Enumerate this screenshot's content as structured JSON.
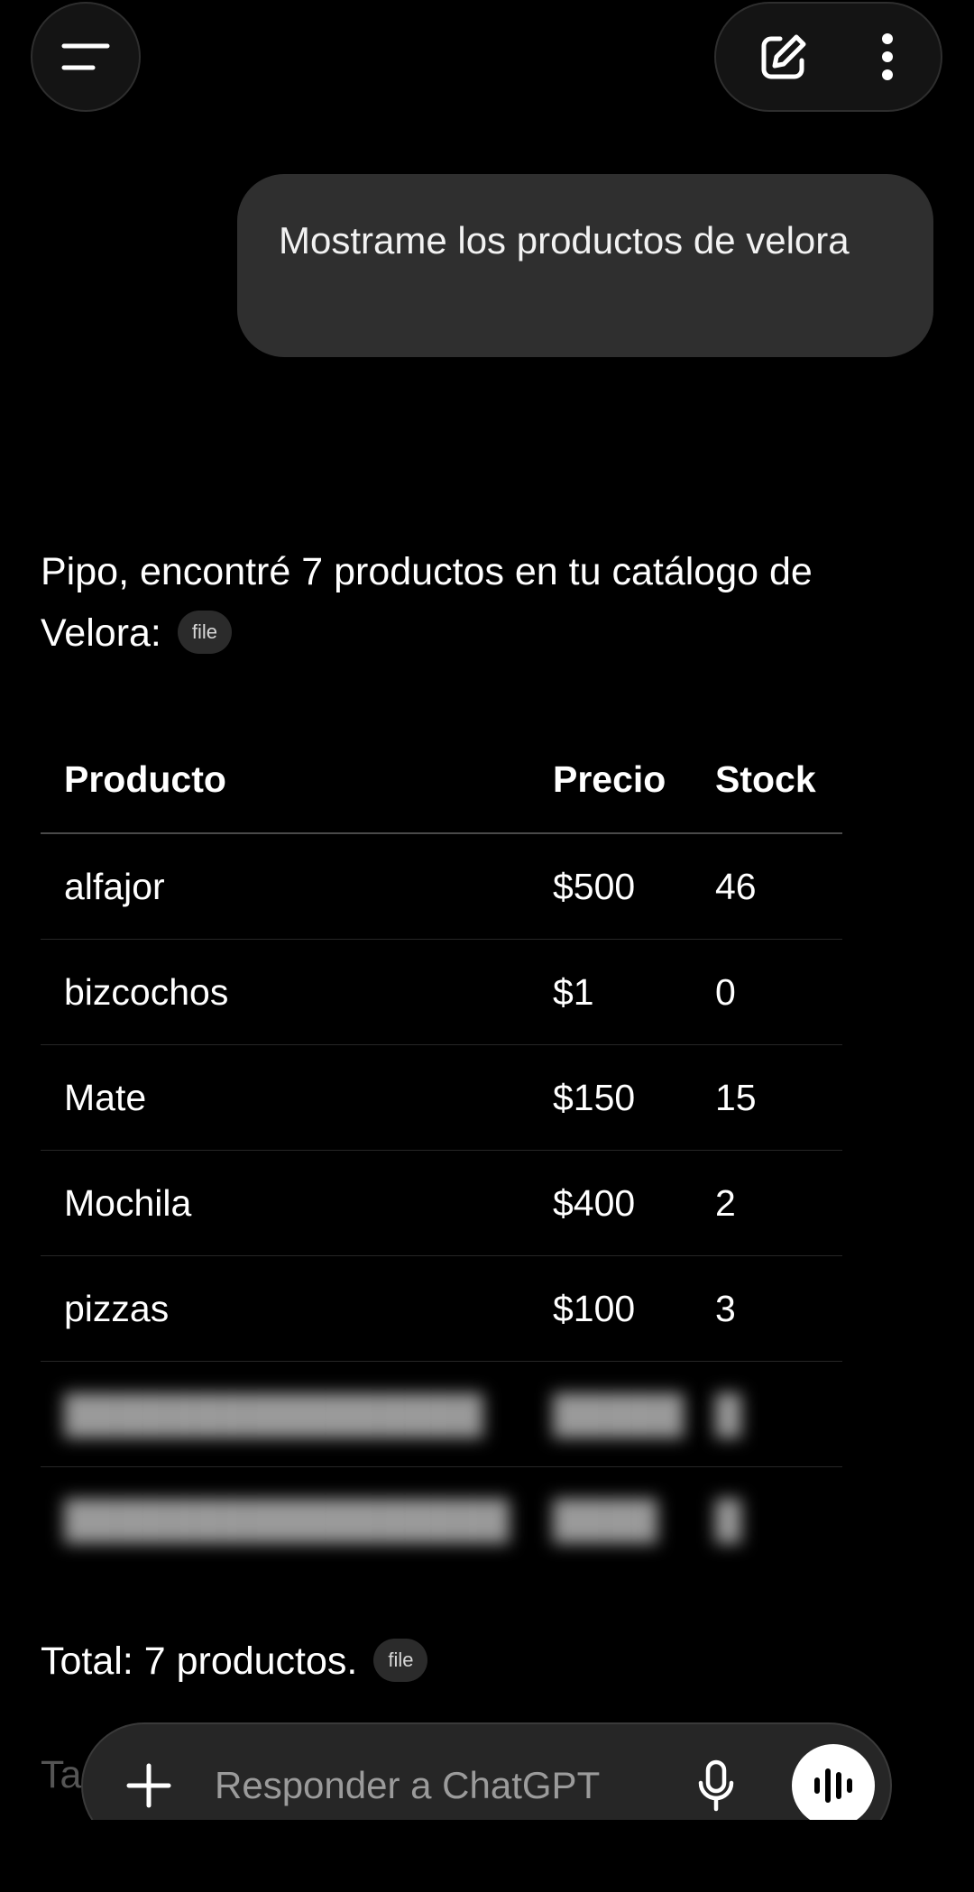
{
  "header": {
    "menu_icon": "menu-icon",
    "new_chat_icon": "new-chat-edit-icon",
    "more_icon": "more-vertical-icon"
  },
  "conversation": {
    "user_message": "Mostrame los productos de velora",
    "assistant_intro": "Pipo, encontré 7 productos en tu catálogo de Velora:",
    "citation_chip": "file",
    "table": {
      "headers": [
        "Producto",
        "Precio",
        "Stock"
      ],
      "rows": [
        [
          "alfajor",
          "$500",
          "46"
        ],
        [
          "bizcochos",
          "$1",
          "0"
        ],
        [
          "Mate",
          "$150",
          "15"
        ],
        [
          "Mochila",
          "$400",
          "2"
        ],
        [
          "pizzas",
          "$100",
          "3"
        ]
      ]
    },
    "total_text": "Total: 7 productos.",
    "total_chip": "file",
    "partial_next_line": "Ta"
  },
  "composer": {
    "placeholder": "Responder a ChatGPT",
    "plus_icon": "plus-icon",
    "mic_icon": "microphone-icon",
    "voice_icon": "voice-mode-icon"
  },
  "colors": {
    "background": "#000000",
    "user_bubble": "#2f2f2f",
    "composer": "#262626"
  }
}
